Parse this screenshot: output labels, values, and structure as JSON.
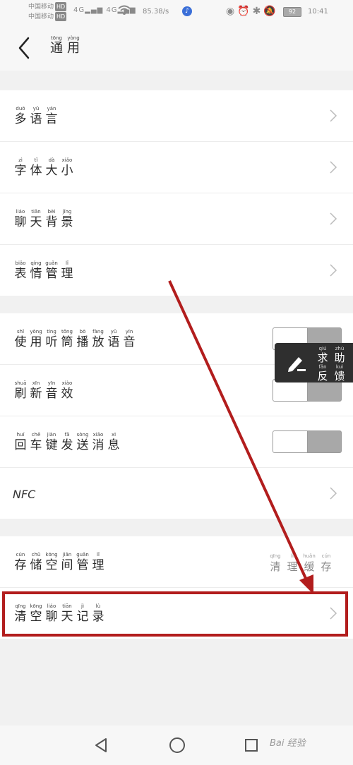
{
  "status_bar": {
    "carrier_1": "中国移动",
    "carrier_2": "中国移动",
    "hd": "HD",
    "signal": "4G",
    "speed": "85.38/s",
    "battery": "92",
    "time": "10:41"
  },
  "header": {
    "title": [
      {
        "p": "tōng",
        "h": "通"
      },
      {
        "p": "yòng",
        "h": "用"
      }
    ]
  },
  "group1": [
    {
      "label": [
        {
          "p": "duō",
          "h": "多"
        },
        {
          "p": "yǔ",
          "h": "语"
        },
        {
          "p": "yán",
          "h": "言"
        }
      ]
    },
    {
      "label": [
        {
          "p": "zì",
          "h": "字"
        },
        {
          "p": "tǐ",
          "h": "体"
        },
        {
          "p": "dà",
          "h": "大"
        },
        {
          "p": "xiǎo",
          "h": "小"
        }
      ]
    },
    {
      "label": [
        {
          "p": "liáo",
          "h": "聊"
        },
        {
          "p": "tiān",
          "h": "天"
        },
        {
          "p": "bèi",
          "h": "背"
        },
        {
          "p": "jǐng",
          "h": "景"
        }
      ]
    },
    {
      "label": [
        {
          "p": "biǎo",
          "h": "表"
        },
        {
          "p": "qíng",
          "h": "情"
        },
        {
          "p": "guǎn",
          "h": "管"
        },
        {
          "p": "lǐ",
          "h": "理"
        }
      ]
    }
  ],
  "group2": [
    {
      "label": [
        {
          "p": "shǐ",
          "h": "使"
        },
        {
          "p": "yòng",
          "h": "用"
        },
        {
          "p": "tīng",
          "h": "听"
        },
        {
          "p": "tǒng",
          "h": "筒"
        },
        {
          "p": "bō",
          "h": "播"
        },
        {
          "p": "fàng",
          "h": "放"
        },
        {
          "p": "yǔ",
          "h": "语"
        },
        {
          "p": "yīn",
          "h": "音"
        }
      ],
      "toggle": "off"
    },
    {
      "label": [
        {
          "p": "shuā",
          "h": "刷"
        },
        {
          "p": "xīn",
          "h": "新"
        },
        {
          "p": "yīn",
          "h": "音"
        },
        {
          "p": "xiào",
          "h": "效"
        }
      ],
      "toggle": "off"
    },
    {
      "label": [
        {
          "p": "huí",
          "h": "回"
        },
        {
          "p": "chē",
          "h": "车"
        },
        {
          "p": "jiàn",
          "h": "键"
        },
        {
          "p": "fā",
          "h": "发"
        },
        {
          "p": "sòng",
          "h": "送"
        },
        {
          "p": "xiāo",
          "h": "消"
        },
        {
          "p": "xī",
          "h": "息"
        }
      ],
      "toggle": "off"
    },
    {
      "nfc": "NFC"
    }
  ],
  "group3": {
    "storage": [
      {
        "p": "cún",
        "h": "存"
      },
      {
        "p": "chǔ",
        "h": "储"
      },
      {
        "p": "kōng",
        "h": "空"
      },
      {
        "p": "jiān",
        "h": "间"
      },
      {
        "p": "guǎn",
        "h": "管"
      },
      {
        "p": "lǐ",
        "h": "理"
      }
    ],
    "storage_right": [
      {
        "p": "qīng",
        "h": "清"
      },
      {
        "p": "lǐ",
        "h": "理"
      },
      {
        "p": "huǎn",
        "h": "缓"
      },
      {
        "p": "cún",
        "h": "存"
      }
    ],
    "clear": [
      {
        "p": "qīng",
        "h": "清"
      },
      {
        "p": "kōng",
        "h": "空"
      },
      {
        "p": "liáo",
        "h": "聊"
      },
      {
        "p": "tiān",
        "h": "天"
      },
      {
        "p": "jì",
        "h": "记"
      },
      {
        "p": "lù",
        "h": "录"
      }
    ]
  },
  "feedback": {
    "row1": [
      {
        "p": "qiú",
        "h": "求"
      },
      {
        "p": "zhù",
        "h": "助"
      }
    ],
    "row2": [
      {
        "p": "fǎn",
        "h": "反"
      },
      {
        "p": "kuì",
        "h": "馈"
      }
    ]
  },
  "watermark": "Bai 经验",
  "colors": {
    "highlight": "#b21d1d",
    "toggle_track": "#a8a8a8",
    "background": "#f1f1f1"
  }
}
